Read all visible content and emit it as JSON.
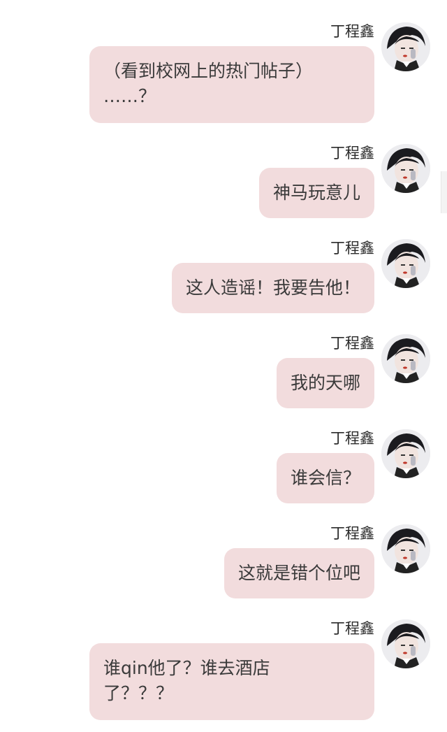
{
  "sender_name": "丁程鑫",
  "messages": [
    {
      "text_lines": [
        "（看到校网上的热门帖子）",
        "……？"
      ]
    },
    {
      "text_lines": [
        "神马玩意儿"
      ]
    },
    {
      "text_lines": [
        "这人造谣！我要告他！"
      ]
    },
    {
      "text_lines": [
        "我的天哪"
      ]
    },
    {
      "text_lines": [
        "谁会信？"
      ]
    },
    {
      "text_lines": [
        "这就是错个位吧"
      ]
    },
    {
      "text_lines": [
        "谁qin他了？谁去酒店",
        "了？？？"
      ]
    }
  ],
  "colors": {
    "bubble": "#f2dcdd",
    "text": "#3a3a3a",
    "name": "#2b2b2b"
  }
}
